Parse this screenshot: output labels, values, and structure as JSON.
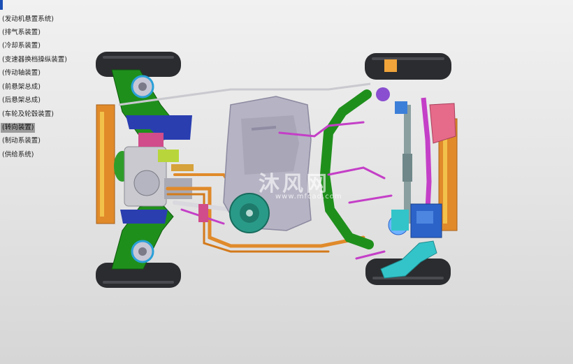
{
  "assembly_tree": {
    "items": [
      {
        "label": "(发动机悬置系统)",
        "selected": false
      },
      {
        "label": "(排气系装置)",
        "selected": false
      },
      {
        "label": "(冷却系装置)",
        "selected": false
      },
      {
        "label": "(变速器换档操纵装置)",
        "selected": false
      },
      {
        "label": "(传动轴装置)",
        "selected": false
      },
      {
        "label": "(前悬架总成)",
        "selected": false
      },
      {
        "label": "(后悬架总成)",
        "selected": false
      },
      {
        "label": "(车轮及轮毂装置)",
        "selected": false
      },
      {
        "label": "(转向装置)",
        "selected": true
      },
      {
        "label": "(制动系装置)",
        "selected": false
      },
      {
        "label": "(供给系统)",
        "selected": false
      }
    ]
  },
  "watermark": {
    "text": "沐风网",
    "url": "www.mfcad.com"
  },
  "colors": {
    "tires": "#2b2c2f",
    "frame_green": "#1f8f1c",
    "fuel_tank": "#b6b3c4",
    "orange_pipe": "#e08a2a",
    "magenta_pipe": "#c43fc7",
    "blue_parts": "#2c63c9",
    "cyan_parts": "#33c4c9",
    "selection_bg": "#9b9b9b"
  }
}
